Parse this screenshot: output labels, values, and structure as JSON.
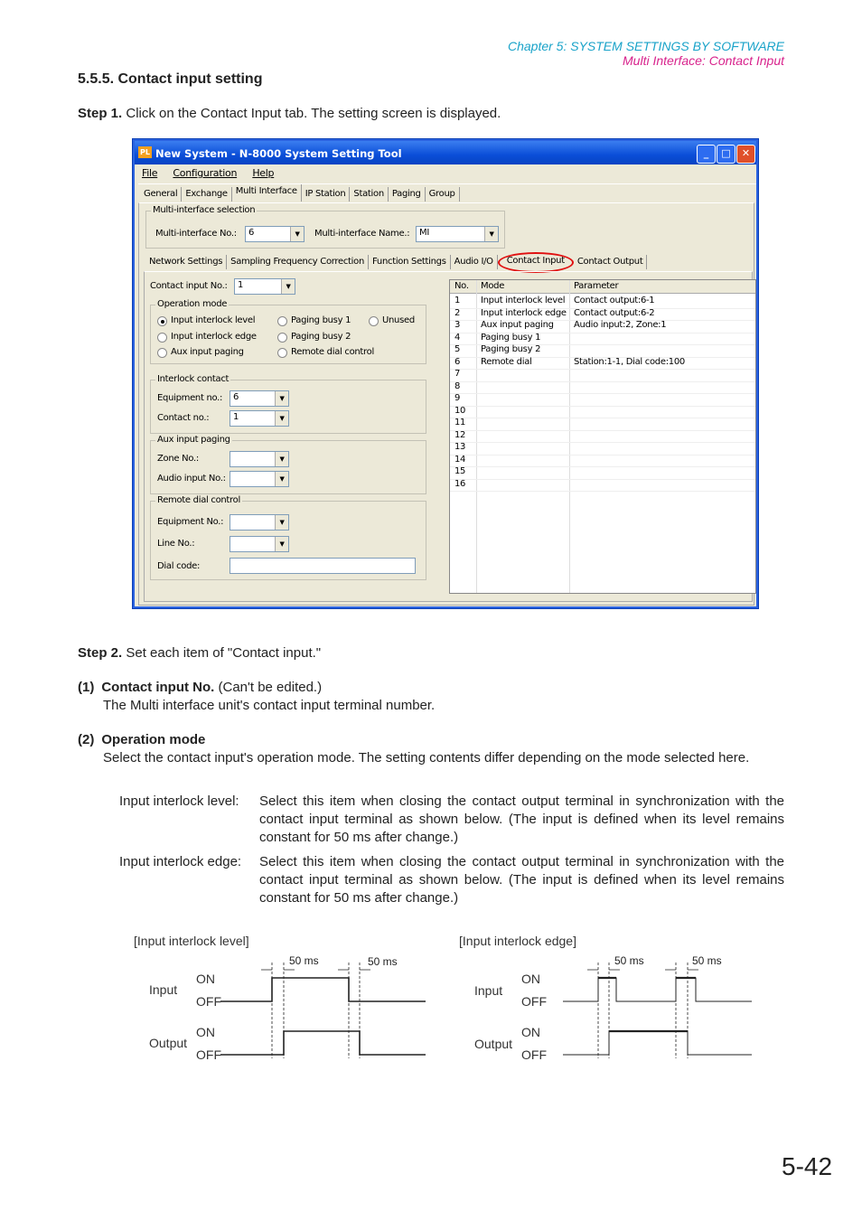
{
  "header": {
    "chapter": "Chapter 5:  SYSTEM SETTINGS BY SOFTWARE",
    "section": "Multi Interface: Contact Input"
  },
  "heading": "5.5.5. Contact input setting",
  "step1": {
    "label": "Step 1.",
    "text": "Click on the Contact Input tab. The setting screen is displayed."
  },
  "window": {
    "title": "New System - N-8000 System Setting Tool",
    "menu": [
      "File",
      "Configuration",
      "Help"
    ],
    "tabs": [
      "General",
      "Exchange",
      "Multi Interface",
      "IP Station",
      "Station",
      "Paging",
      "Group"
    ],
    "active_tab": "Multi Interface",
    "selection": {
      "title": "Multi-interface selection",
      "no_label": "Multi-interface No.:",
      "no_value": "6",
      "name_label": "Multi-interface Name.:",
      "name_value": "MI"
    },
    "subtabs": [
      "Network Settings",
      "Sampling Frequency Correction",
      "Function Settings",
      "Audio I/O",
      "Contact Input",
      "Contact Output"
    ],
    "active_subtab": "Contact Input",
    "highlight_color": "#e01010",
    "contact_input_no": {
      "label": "Contact input No.:",
      "value": "1"
    },
    "operation_mode": {
      "title": "Operation mode",
      "options": [
        "Input interlock level",
        "Input interlock edge",
        "Aux input paging",
        "Paging busy 1",
        "Paging busy 2",
        "Remote dial control",
        "Unused"
      ],
      "selected": "Input interlock level"
    },
    "interlock": {
      "title": "Interlock contact",
      "equip_label": "Equipment no.:",
      "equip_value": "6",
      "contact_label": "Contact no.:",
      "contact_value": "1"
    },
    "aux": {
      "title": "Aux input paging",
      "zone_label": "Zone No.:",
      "zone_value": "",
      "audio_label": "Audio input No.:",
      "audio_value": ""
    },
    "remote": {
      "title": "Remote dial control",
      "equip_label": "Equipment No.:",
      "equip_value": "",
      "line_label": "Line No.:",
      "line_value": "",
      "dial_label": "Dial code:",
      "dial_value": ""
    },
    "list": {
      "columns": [
        "No.",
        "Mode",
        "Parameter"
      ],
      "rows": [
        [
          "1",
          "Input interlock level",
          "Contact output:6-1"
        ],
        [
          "2",
          "Input interlock edge",
          "Contact output:6-2"
        ],
        [
          "3",
          "Aux input paging",
          "Audio input:2, Zone:1"
        ],
        [
          "4",
          "Paging busy 1",
          ""
        ],
        [
          "5",
          "Paging busy 2",
          ""
        ],
        [
          "6",
          "Remote dial",
          "Station:1-1, Dial code:100"
        ],
        [
          "7",
          "",
          ""
        ],
        [
          "8",
          "",
          ""
        ],
        [
          "9",
          "",
          ""
        ],
        [
          "10",
          "",
          ""
        ],
        [
          "11",
          "",
          ""
        ],
        [
          "12",
          "",
          ""
        ],
        [
          "13",
          "",
          ""
        ],
        [
          "14",
          "",
          ""
        ],
        [
          "15",
          "",
          ""
        ],
        [
          "16",
          "",
          ""
        ]
      ]
    }
  },
  "step2": {
    "label": "Step 2.",
    "text": "Set each item of \"Contact input.\""
  },
  "item1": {
    "num": "(1)",
    "title": "Contact input No.",
    "suffix": " (Can't be edited.)",
    "desc": "The Multi interface unit's contact input terminal number."
  },
  "item2": {
    "num": "(2)",
    "title": "Operation mode",
    "desc": "Select the contact input's operation mode. The setting contents differ depending on the mode selected here.",
    "defs": [
      {
        "term": "Input interlock level:",
        "text": "Select this item when closing the contact output terminal in synchronization with the contact input terminal as shown below. (The input is defined when its level remains constant for 50 ms after change.)"
      },
      {
        "term": "Input interlock edge:",
        "text": "Select this item when closing the contact output terminal in synchronization with the contact input terminal as shown below. (The input is defined when its level remains constant for 50 ms after change.)"
      }
    ]
  },
  "diagrams": [
    {
      "title": "[Input interlock level]",
      "delay": "50 ms",
      "input": "Input",
      "output": "Output",
      "on": "ON",
      "off": "OFF"
    },
    {
      "title": "[Input interlock edge]",
      "delay": "50 ms",
      "input": "Input",
      "output": "Output",
      "on": "ON",
      "off": "OFF"
    }
  ],
  "page_number": "5-42"
}
